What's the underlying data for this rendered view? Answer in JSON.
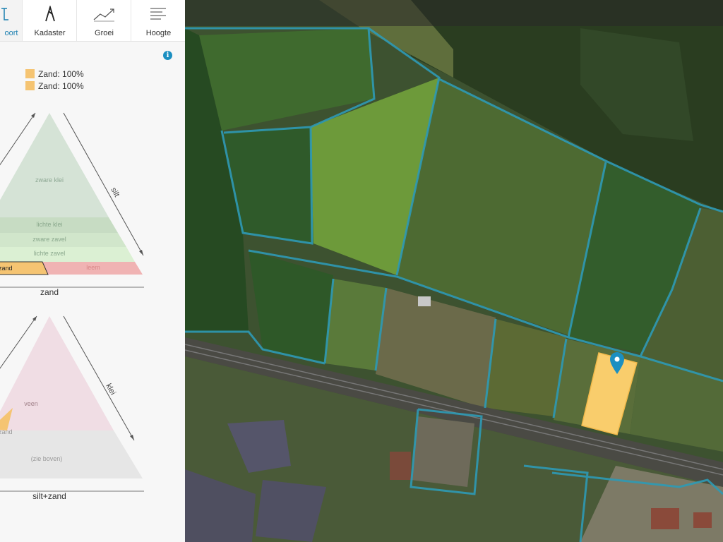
{
  "tabs": [
    {
      "label": "oort",
      "icon": "soil-type-icon",
      "active": true
    },
    {
      "label": "Kadaster",
      "icon": "kadaster-icon",
      "active": false
    },
    {
      "label": "Groei",
      "icon": "growth-chart-icon",
      "active": false
    },
    {
      "label": "Hoogte",
      "icon": "height-lines-icon",
      "active": false
    }
  ],
  "legend": [
    {
      "label": "Zand: 100%",
      "color": "#f5c472"
    },
    {
      "label": "Zand: 100%",
      "color": "#f5c472"
    }
  ],
  "triangle1": {
    "right_axis": "silt",
    "bottom_label": "zand",
    "zones": {
      "zware_klei": "zware klei",
      "lichte_klei": "lichte klei",
      "zware_zavel": "zware zavel",
      "lichte_zavel": "lichte zavel",
      "zand": "zand",
      "leem": "leem"
    },
    "colors": {
      "zware_klei": "#d5e3d6",
      "lichte_klei": "#c7dcc3",
      "zware_zavel": "#d1e6cb",
      "lichte_zavel": "#dbf0d3",
      "zand": "#f5c472",
      "leem": "#f0b3b3"
    }
  },
  "triangle2": {
    "right_axis": "klei",
    "bottom_label": "silt+zand",
    "zones": {
      "veen": "veen",
      "zand": "zand",
      "zie_boven": "(zie boven)"
    },
    "colors": {
      "veen": "#f0dde4",
      "lower": "#e6e6e6",
      "highlight": "#f5c472"
    }
  },
  "map": {
    "parcel_outline_color": "#2e9ab5",
    "selected_parcel_color": "#f9cd6c",
    "marker_color": "#1b8fc1"
  }
}
